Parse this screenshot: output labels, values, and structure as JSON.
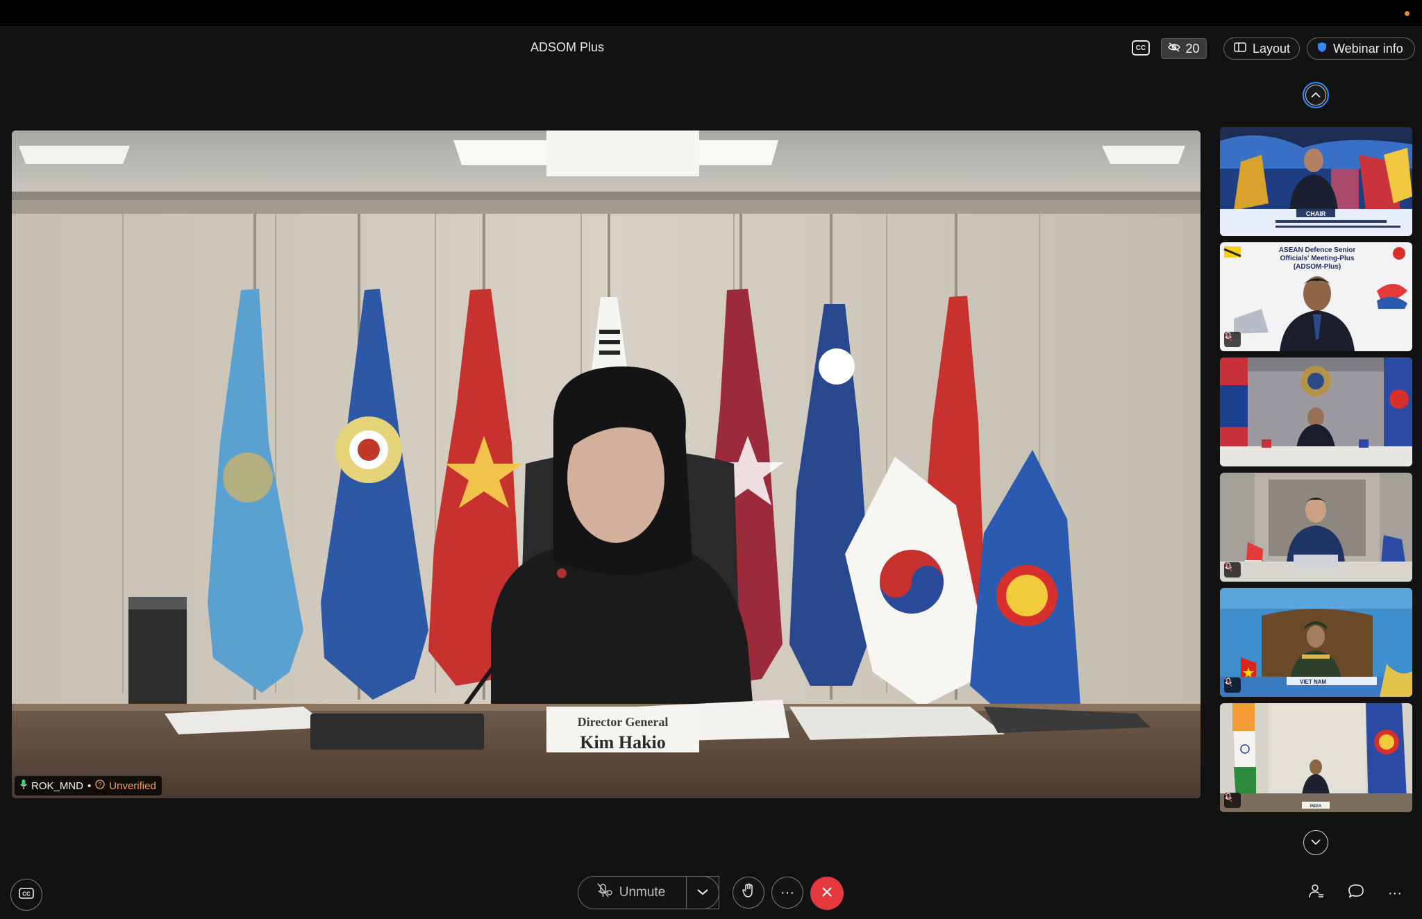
{
  "window": {
    "title": "ADSOM Plus"
  },
  "header": {
    "cc_label": "CC",
    "viewer_count": "20",
    "layout_label": "Layout",
    "webinar_info_label": "Webinar info"
  },
  "stage": {
    "participant_name": "ROK_MND",
    "separator": "•",
    "verification_status": "Unverified",
    "nameplate_line1": "Director General",
    "nameplate_line2": "Kim Hakio"
  },
  "sidebar": {
    "thumbnails": [
      {
        "id": "chair",
        "label": "CHAIR",
        "muted": false
      },
      {
        "id": "brunei",
        "caption_lines": [
          "ASEAN Defence Senior",
          "Officials' Meeting-Plus",
          "(ADSOM-Plus)"
        ],
        "muted": true
      },
      {
        "id": "cambodia",
        "muted": false
      },
      {
        "id": "singapore",
        "muted": true
      },
      {
        "id": "vietnam",
        "label": "VIET NAM",
        "muted": true
      },
      {
        "id": "india",
        "label": "INDIA",
        "muted": true
      }
    ]
  },
  "controls": {
    "unmute_label": "Unmute",
    "more_label": "···"
  },
  "colors": {
    "accent_blue": "#2f8fff",
    "leave_red": "#e5393f",
    "unverified_orange": "#f1a35a"
  }
}
